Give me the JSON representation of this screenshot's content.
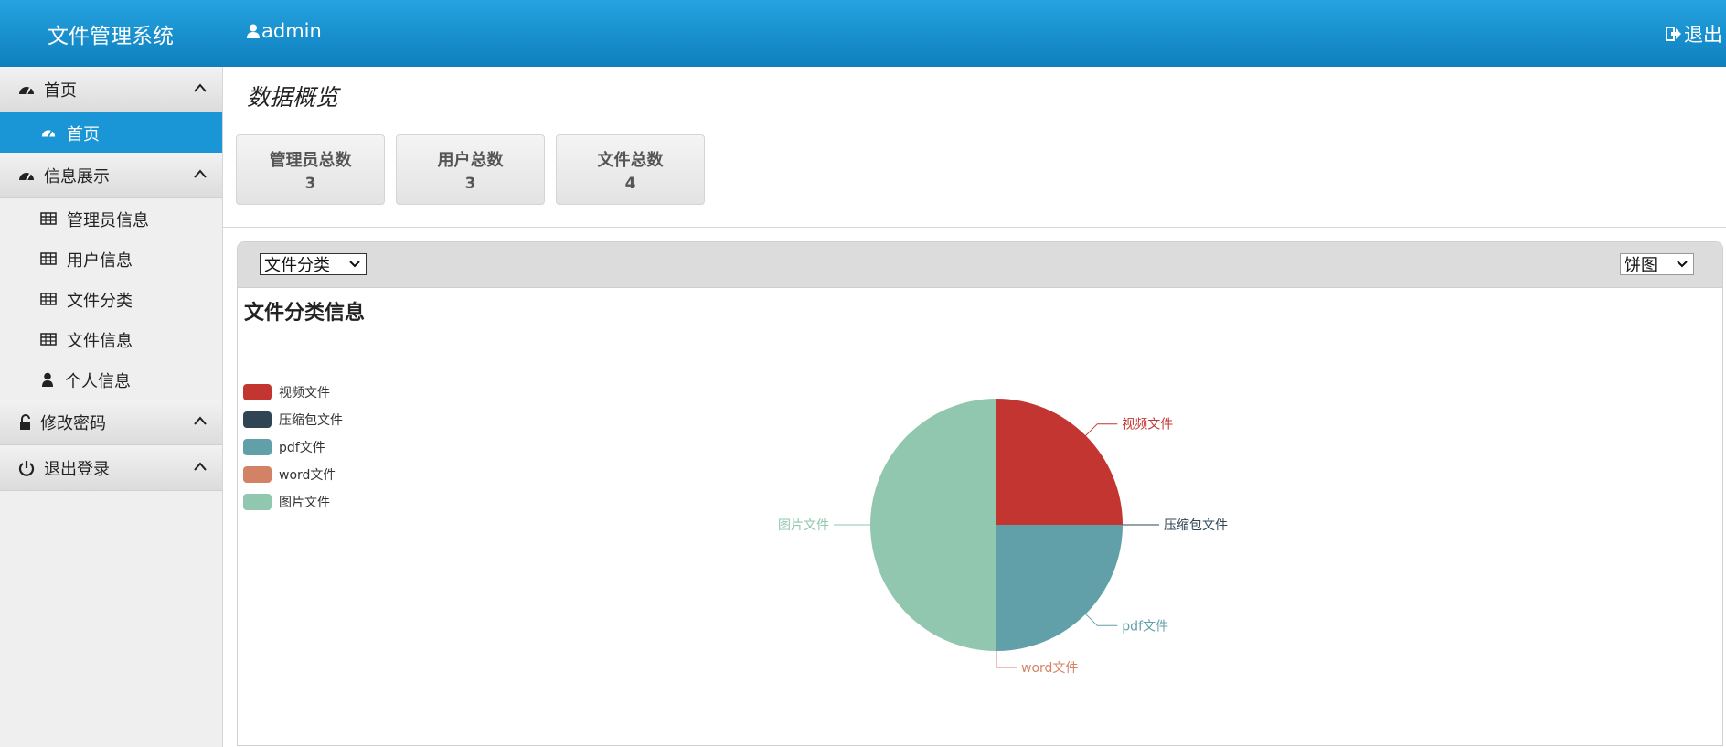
{
  "header": {
    "title": "文件管理系统",
    "username": "admin",
    "logout_label": "退出"
  },
  "sidebar": {
    "groups": [
      {
        "label": "首页",
        "items": [
          {
            "label": "首页",
            "active": true
          }
        ]
      },
      {
        "label": "信息展示",
        "items": [
          {
            "label": "管理员信息"
          },
          {
            "label": "用户信息"
          },
          {
            "label": "文件分类"
          },
          {
            "label": "文件信息"
          },
          {
            "label": "个人信息"
          }
        ]
      },
      {
        "label": "修改密码"
      },
      {
        "label": "退出登录"
      }
    ]
  },
  "main": {
    "page_title": "数据概览",
    "stats": [
      {
        "label": "管理员总数",
        "value": "3"
      },
      {
        "label": "用户总数",
        "value": "3"
      },
      {
        "label": "文件总数",
        "value": "4"
      }
    ],
    "category_select": "文件分类",
    "chart_type_select": "饼图"
  },
  "chart_data": {
    "type": "pie",
    "title": "文件分类信息",
    "legend_position": "left",
    "categories": [
      "视频文件",
      "压缩包文件",
      "pdf文件",
      "word文件",
      "图片文件"
    ],
    "values": [
      1,
      0,
      1,
      0,
      2
    ],
    "colors": [
      "#c23531",
      "#2f4554",
      "#61a0a8",
      "#d48265",
      "#91c7ae"
    ]
  },
  "colors": {
    "header": "#1a95d5",
    "active_item": "#1a95d5"
  }
}
